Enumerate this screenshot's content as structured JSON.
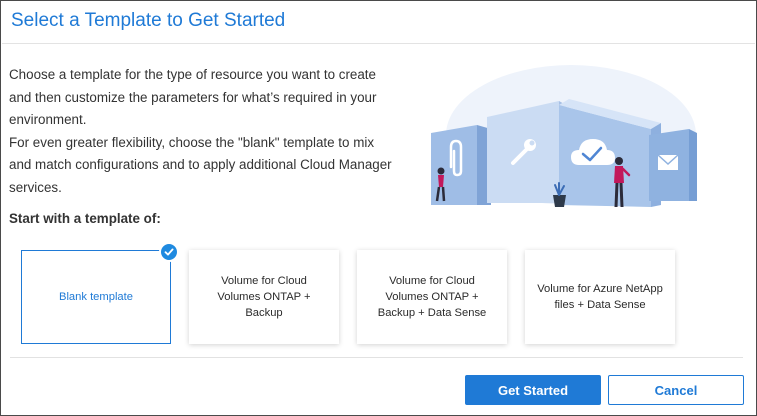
{
  "dialog": {
    "title": "Select a Template to Get Started",
    "intro": [
      "Choose a template for the type of resource you want to create and then customize the parameters for what’s required in your environment.",
      "For even greater flexibility, choose the \"blank\" template to mix and match configurations and to apply additional Cloud Manager services."
    ],
    "templates_heading": "Start with a template of:"
  },
  "templates": [
    {
      "label": "Blank template",
      "selected": true
    },
    {
      "label": "Volume for Cloud Volumes ONTAP + Backup",
      "selected": false
    },
    {
      "label": "Volume for Cloud Volumes ONTAP + Backup + Data Sense",
      "selected": false
    },
    {
      "label": "Volume for Azure NetApp files + Data Sense",
      "selected": false
    }
  ],
  "footer": {
    "primary_label": "Get Started",
    "secondary_label": "Cancel"
  },
  "colors": {
    "accent": "#1f7ad6",
    "text": "#333333",
    "illustration_blue": "#a9c5ea"
  },
  "icons": [
    "check-icon",
    "paperclip-icon",
    "wrench-icon",
    "cloud-check-icon",
    "envelope-icon"
  ]
}
